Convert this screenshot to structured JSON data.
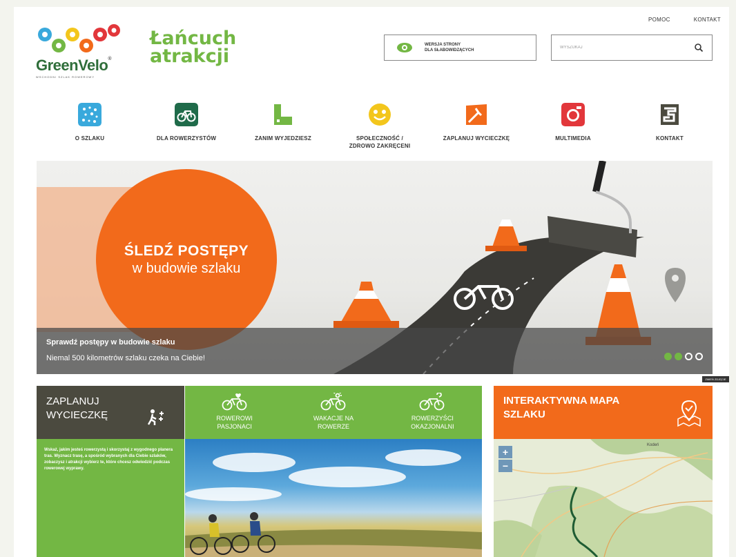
{
  "header": {
    "top_links": [
      "POMOC",
      "KONTAKT"
    ],
    "logo": {
      "brand_green": "Green",
      "brand_velo": "Velo",
      "registered": "®",
      "subtitle": "WSCHODNI SZLAK ROWEROWY"
    },
    "tagline_line1": "Łańcuch",
    "tagline_line2": "atrakcji",
    "accessibility_line1": "WERSJA STRONY",
    "accessibility_line2": "DLA SŁABOWIDZĄCYCH",
    "search_placeholder": "WYSZUKAJ"
  },
  "nav": [
    {
      "label": "O SZLAKU",
      "color": "#39a9dc",
      "icon": "dots-icon"
    },
    {
      "label": "DLA ROWERZYSTÓW",
      "color": "#1f6b4a",
      "icon": "bicycle-icon"
    },
    {
      "label": "ZANIM WYJEDZIESZ",
      "color": "#73b744",
      "icon": "boot-icon"
    },
    {
      "label": "SPOŁECZNOŚĆ /",
      "label2": "ZDROWO ZAKRĘCENI",
      "color": "#f3c61c",
      "icon": "smile-icon"
    },
    {
      "label": "ZAPLANUJ WYCIECZKĘ",
      "color": "#f26a1b",
      "icon": "map-icon"
    },
    {
      "label": "MULTIMEDIA",
      "color": "#e2373b",
      "icon": "camera-icon"
    },
    {
      "label": "KONTAKT",
      "color": "#4b4a3f",
      "icon": "phone-icon"
    }
  ],
  "hero": {
    "title": "ŚLEDŹ POSTĘPY",
    "subtitle": "w budowie szlaku",
    "caption1": "Sprawdź postępy w budowie szlaku",
    "caption2": "Niemal 500 kilometrów szlaku czeka na Ciebie!",
    "change_label": "ZMIEŃ ZDJĘCIE",
    "slides_total": 4,
    "slide_active": 2
  },
  "plan": {
    "title_line1": "ZAPLANUJ",
    "title_line2": "WYCIECZKĘ",
    "description": "Wskaż, jakim jesteś rowerzystą i skorzystaj z wygodnego planera tras. Wyznacz trasę, a spośród wybranych dla Ciebie szlaków, zobaczysz i atrakcji wybierz te, które chcesz odwiedzić podczas rowerowej wyprawy."
  },
  "cyclist_tabs": [
    {
      "line1": "ROWEROWI",
      "line2": "PASJONACI"
    },
    {
      "line1": "WAKACJE NA",
      "line2": "ROWERZE"
    },
    {
      "line1": "ROWERZYŚCI",
      "line2": "OKAZJONALNI"
    }
  ],
  "map": {
    "title_line1": "INTERAKTYWNA MAPA",
    "title_line2": "SZLAKU",
    "zoom_in": "+",
    "zoom_out": "−",
    "city_label": "Kodeń"
  },
  "colors": {
    "green": "#73b744",
    "orange": "#f26a1b",
    "dark": "#4b4a3f"
  }
}
